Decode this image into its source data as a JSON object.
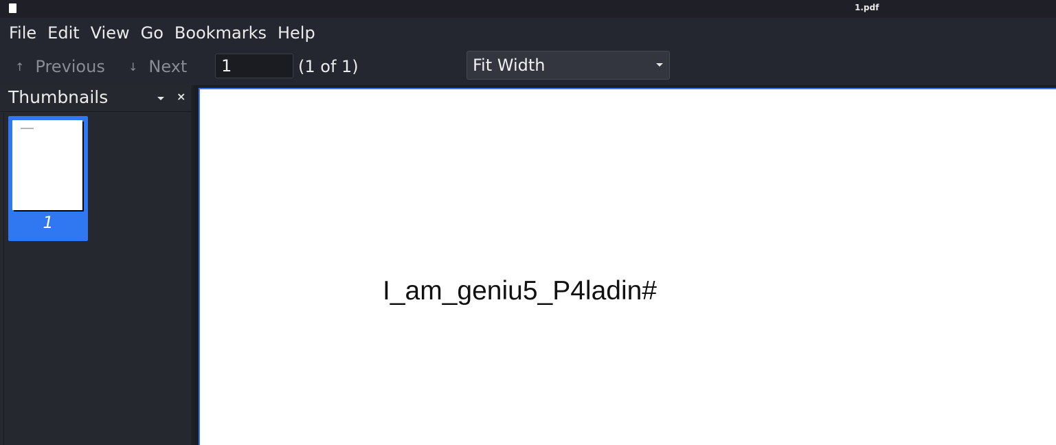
{
  "window": {
    "title": "1.pdf"
  },
  "menu": {
    "items": [
      "File",
      "Edit",
      "View",
      "Go",
      "Bookmarks",
      "Help"
    ]
  },
  "toolbar": {
    "previous_label": "Previous",
    "previous_arrow": "↑",
    "next_label": "Next",
    "next_arrow": "↓",
    "page_value": "1",
    "page_count": "(1 of 1)",
    "zoom_value": "Fit Width"
  },
  "sidebar": {
    "title": "Thumbnails",
    "close_glyph": "×",
    "thumbnails": [
      {
        "label": "1",
        "selected": true
      }
    ]
  },
  "document": {
    "text": "I_am_geniu5_P4ladin#"
  },
  "colors": {
    "accent": "#2f78f2",
    "background": "#262830",
    "page": "#ffffff"
  },
  "icons": {
    "app": "document-icon",
    "previous": "arrow-up-icon",
    "next": "arrow-down-icon",
    "zoom_dropdown": "caret-down-icon",
    "sidebar_dropdown": "caret-down-icon",
    "sidebar_close": "close-icon"
  }
}
